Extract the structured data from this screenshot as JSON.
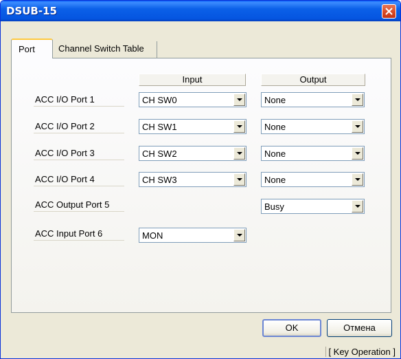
{
  "window": {
    "title": "DSUB-15"
  },
  "tabs": [
    {
      "label": "Port",
      "active": true
    },
    {
      "label": "Channel Switch Table",
      "active": false
    }
  ],
  "columns": {
    "input": "Input",
    "output": "Output"
  },
  "ports": [
    {
      "label": "ACC I/O Port 1",
      "input": "CH SW0",
      "output": "None"
    },
    {
      "label": "ACC I/O Port 2",
      "input": "CH SW1",
      "output": "None"
    },
    {
      "label": "ACC I/O Port 3",
      "input": "CH SW2",
      "output": "None"
    },
    {
      "label": "ACC I/O Port 4",
      "input": "CH SW3",
      "output": "None"
    },
    {
      "label": "ACC Output Port 5",
      "output": "Busy"
    },
    {
      "label": "ACC Input Port 6",
      "input": "MON"
    }
  ],
  "buttons": {
    "ok": "OK",
    "cancel": "Отмена"
  },
  "status": "[ Key Operation ]",
  "colors": {
    "titlebar": "#0555e0",
    "close": "#d94a25",
    "face": "#ece9d8"
  }
}
